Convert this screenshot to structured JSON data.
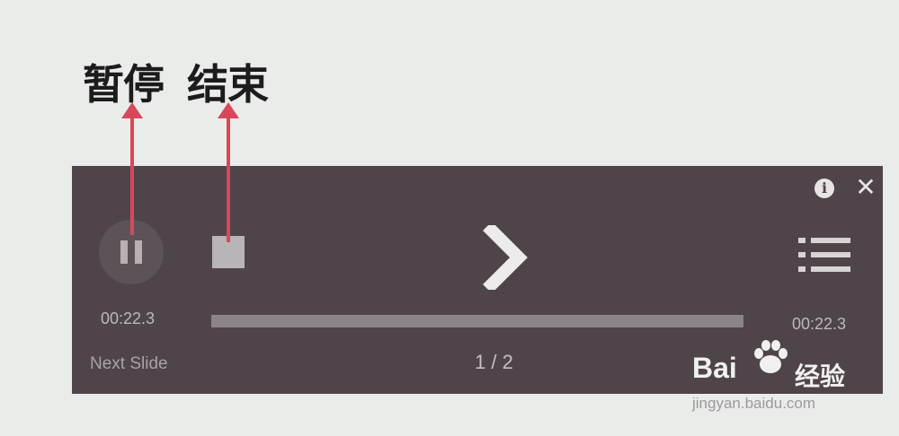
{
  "annotations": {
    "pause_label": "暂停",
    "stop_label": "结束",
    "arrow_color": "#d9475a"
  },
  "player": {
    "elapsed_time": "00:22.3",
    "total_time": "00:22.3",
    "next_slide_label": "Next Slide",
    "slide_counter": "1 / 2",
    "progress_percent": 100,
    "background_color": "#4e444a",
    "icons": [
      "pause-icon",
      "stop-icon",
      "next-arrow-icon",
      "slide-list-icon",
      "info-icon",
      "close-icon"
    ]
  },
  "watermark": {
    "logo_text": "Bai",
    "logo_suffix": "经验",
    "url": "jingyan.baidu.com"
  }
}
